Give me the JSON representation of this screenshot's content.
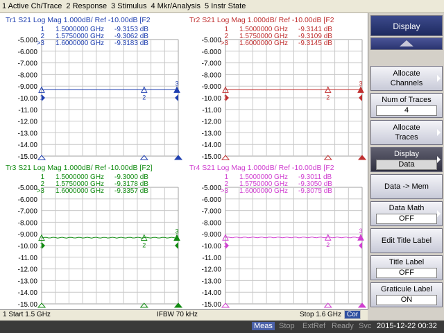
{
  "menu": [
    "1 Active Ch/Trace",
    "2 Response",
    "3 Stimulus",
    "4 Mkr/Analysis",
    "5 Instr State"
  ],
  "y_ticks": [
    "-5.000",
    "-6.000",
    "-7.000",
    "-8.000",
    "-9.000",
    "-10.00",
    "-11.00",
    "-12.00",
    "-13.00",
    "-14.00",
    "-15.00"
  ],
  "traces": [
    {
      "title": "Tr1  S21  Log Mag 1.000dB/ Ref -10.00dB  [F2",
      "color": "#2040b0",
      "trace_level_db": -9.31,
      "markers": [
        {
          "label": "1",
          "freq": "1.5000000 GHz",
          "value": "-9.3153 dB"
        },
        {
          "label": "2",
          "freq": "1.5750000 GHz",
          "value": "-9.3062 dB"
        },
        {
          "label": ">3",
          "freq": "1.6000000 GHz",
          "value": "-9.3183 dB"
        }
      ]
    },
    {
      "title": "Tr2  S21  Log Mag 1.000dB/ Ref -10.00dB  [F2",
      "color": "#c03030",
      "trace_level_db": -9.31,
      "markers": [
        {
          "label": "1",
          "freq": "1.5000000 GHz",
          "value": "-9.3141 dB"
        },
        {
          "label": "2",
          "freq": "1.5750000 GHz",
          "value": "-9.3109 dB"
        },
        {
          "label": ">3",
          "freq": "1.6000000 GHz",
          "value": "-9.3145 dB"
        }
      ]
    },
    {
      "title": "Tr3  S21  Log Mag 1.000dB/ Ref -10.00dB  [F2]",
      "color": "#108a10",
      "trace_level_db": -9.32,
      "markers": [
        {
          "label": "1",
          "freq": "1.5000000 GHz",
          "value": "-9.3000 dB"
        },
        {
          "label": "2",
          "freq": "1.5750000 GHz",
          "value": "-9.3178 dB"
        },
        {
          "label": ">3",
          "freq": "1.6000000 GHz",
          "value": "-9.3357 dB"
        }
      ]
    },
    {
      "title": "Tr4  S21  Log Mag 1.000dB/ Ref -10.00dB  [F2",
      "color": "#d040d0",
      "trace_level_db": -9.3,
      "markers": [
        {
          "label": "1",
          "freq": "1.5000000 GHz",
          "value": "-9.3011 dB"
        },
        {
          "label": "2",
          "freq": "1.5750000 GHz",
          "value": "-9.3050 dB"
        },
        {
          "label": ">3",
          "freq": "1.6000000 GHz",
          "value": "-9.3075 dB"
        }
      ]
    }
  ],
  "softkeys": {
    "title": "Display",
    "allocate_channels": "Allocate\nChannels",
    "num_traces_label": "Num of Traces",
    "num_traces_value": "4",
    "allocate_traces": "Allocate\nTraces",
    "display_label": "Display",
    "display_value": "Data",
    "data_mem": "Data -> Mem",
    "data_math_label": "Data Math",
    "data_math_value": "OFF",
    "edit_title": "Edit Title Label",
    "title_label_label": "Title Label",
    "title_label_value": "OFF",
    "graticule_label": "Graticule Label",
    "graticule_value": "ON"
  },
  "status": {
    "start": "1  Start 1.5 GHz",
    "ifbw": "IFBW 70 kHz",
    "stop": "Stop 1.6 GHz",
    "cor": "Cor",
    "meas": "Meas",
    "stop_state": "Stop",
    "extref": "ExtRef",
    "ready": "Ready",
    "svc": "Svc",
    "datetime": "2015-12-22 00:32"
  },
  "colors": {
    "grid": "#c8c8c8",
    "marker_text_dim": "#888888"
  }
}
